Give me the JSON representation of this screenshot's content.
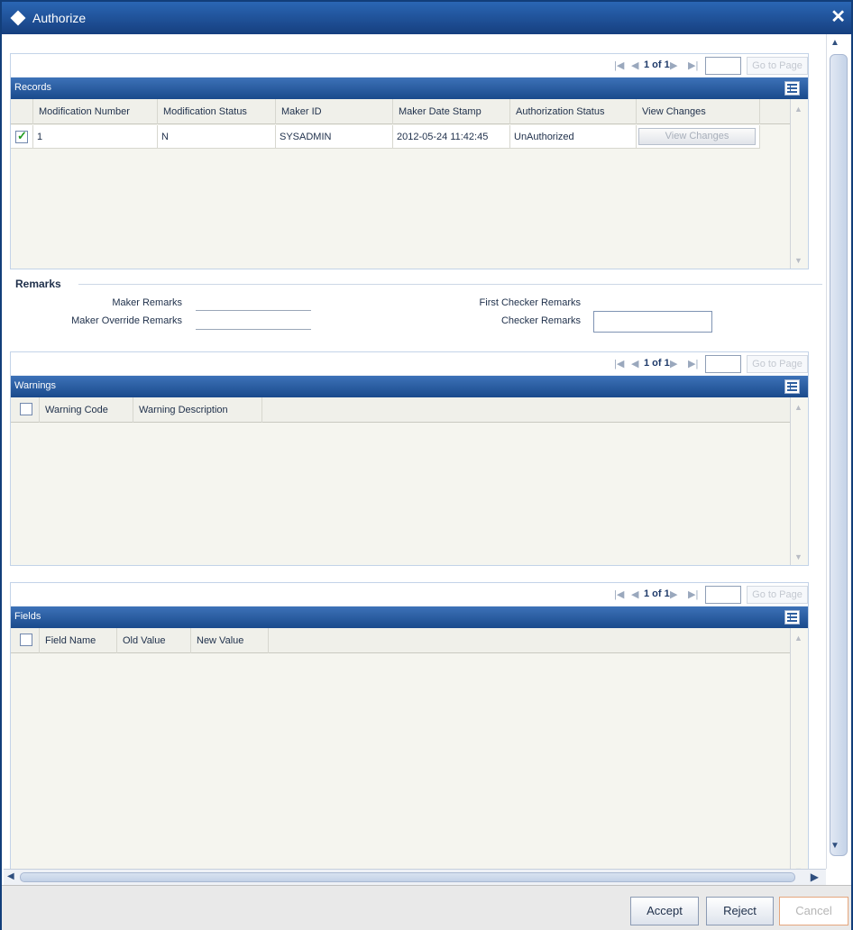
{
  "window": {
    "title": "Authorize",
    "close_glyph": "✕"
  },
  "records": {
    "pager": {
      "page_info": "1 of 1",
      "goto_label": "Go to Page"
    },
    "header": "Records",
    "columns": [
      "Modification Number",
      "Modification Status",
      "Maker ID",
      "Maker Date Stamp",
      "Authorization Status",
      "View Changes"
    ],
    "rows": [
      {
        "checked": true,
        "modification_number": "1",
        "modification_status": "N",
        "maker_id": "SYSADMIN",
        "maker_date_stamp": "2012-05-24 11:42:45",
        "authorization_status": "UnAuthorized",
        "view_changes_label": "View Changes"
      }
    ]
  },
  "remarks": {
    "legend": "Remarks",
    "maker_remarks_label": "Maker Remarks",
    "maker_override_remarks_label": "Maker Override Remarks",
    "first_checker_remarks_label": "First Checker Remarks",
    "checker_remarks_label": "Checker Remarks",
    "checker_remarks_value": ""
  },
  "warnings": {
    "pager": {
      "page_info": "1 of 1",
      "goto_label": "Go to Page"
    },
    "header": "Warnings",
    "columns": [
      "Warning Code",
      "Warning Description"
    ]
  },
  "fields": {
    "pager": {
      "page_info": "1 of 1",
      "goto_label": "Go to Page"
    },
    "header": "Fields",
    "columns": [
      "Field Name",
      "Old Value",
      "New Value"
    ]
  },
  "buttons": {
    "accept": "Accept",
    "reject": "Reject",
    "cancel": "Cancel"
  },
  "icons": {
    "title": "diamond-icon",
    "close": "close-icon",
    "pager_first": "first-page-icon",
    "pager_prev": "prev-page-icon",
    "pager_next": "next-page-icon",
    "pager_last": "last-page-icon",
    "grid_settings": "grid-settings-icon"
  },
  "colors": {
    "titlebar": "#1f55a0",
    "header_bar": "#2a5c9e",
    "grid_bg": "#f5f5ef",
    "cancel_border": "#e5a67d"
  }
}
